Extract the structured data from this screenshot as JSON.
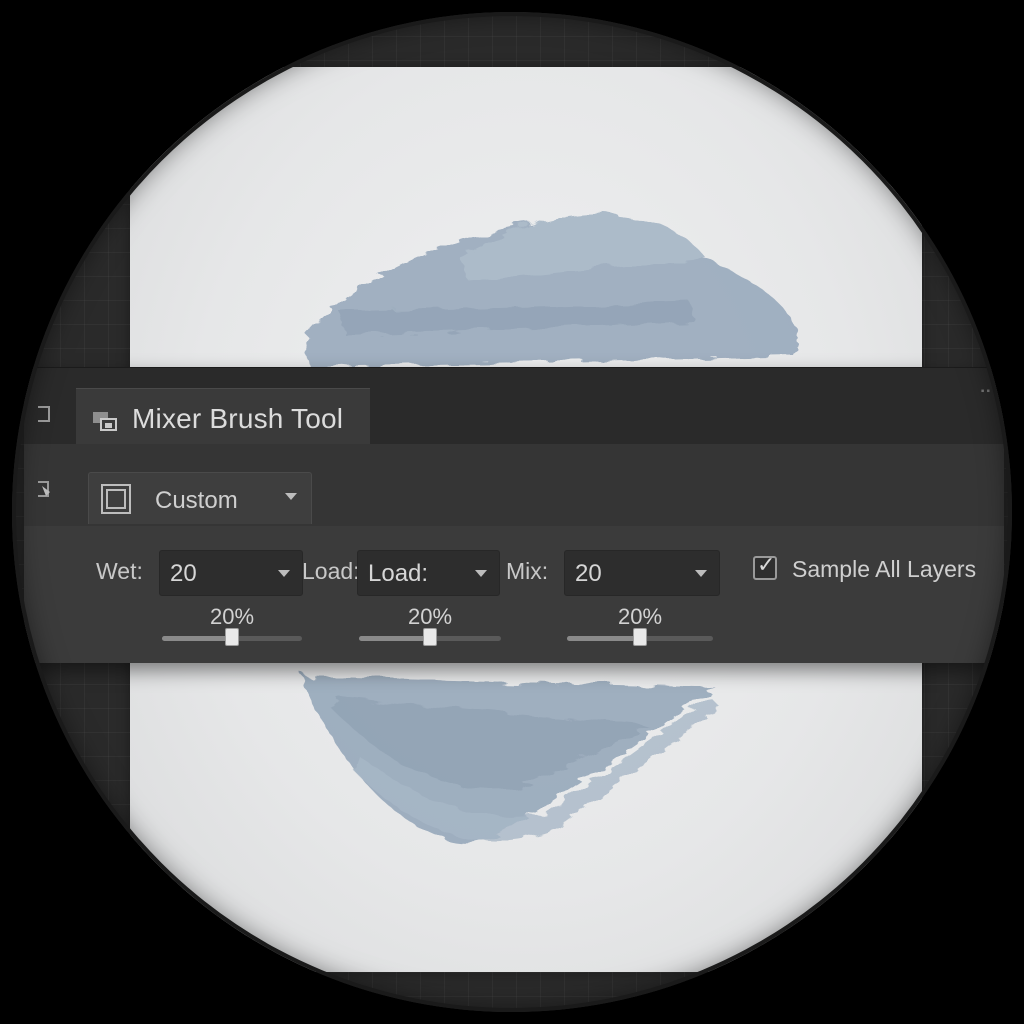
{
  "panel": {
    "title": "Mixer Brush Tool",
    "icons": {
      "tool": "mixer-brush-icon",
      "edge_left": "panel-edge-icon",
      "brush_edge": "brush-load-icon",
      "preset": "brush-preset-icon"
    }
  },
  "preset": {
    "label": "Custom"
  },
  "controls": {
    "wet": {
      "label": "Wet:",
      "value": "20",
      "percent": "20%",
      "level": 0.5
    },
    "load": {
      "label": "Load:",
      "value": "Load:",
      "percent": "20%",
      "level": 0.5
    },
    "mix": {
      "label": "Mix:",
      "value": "20",
      "percent": "20%",
      "level": 0.5
    }
  },
  "sample_all_layers": {
    "label": "Sample All Layers",
    "checked": true
  },
  "colors": {
    "paint_stroke": "#98a9bb",
    "panel_bg": "#3b3b3b",
    "canvas_bg": "#ececec"
  }
}
